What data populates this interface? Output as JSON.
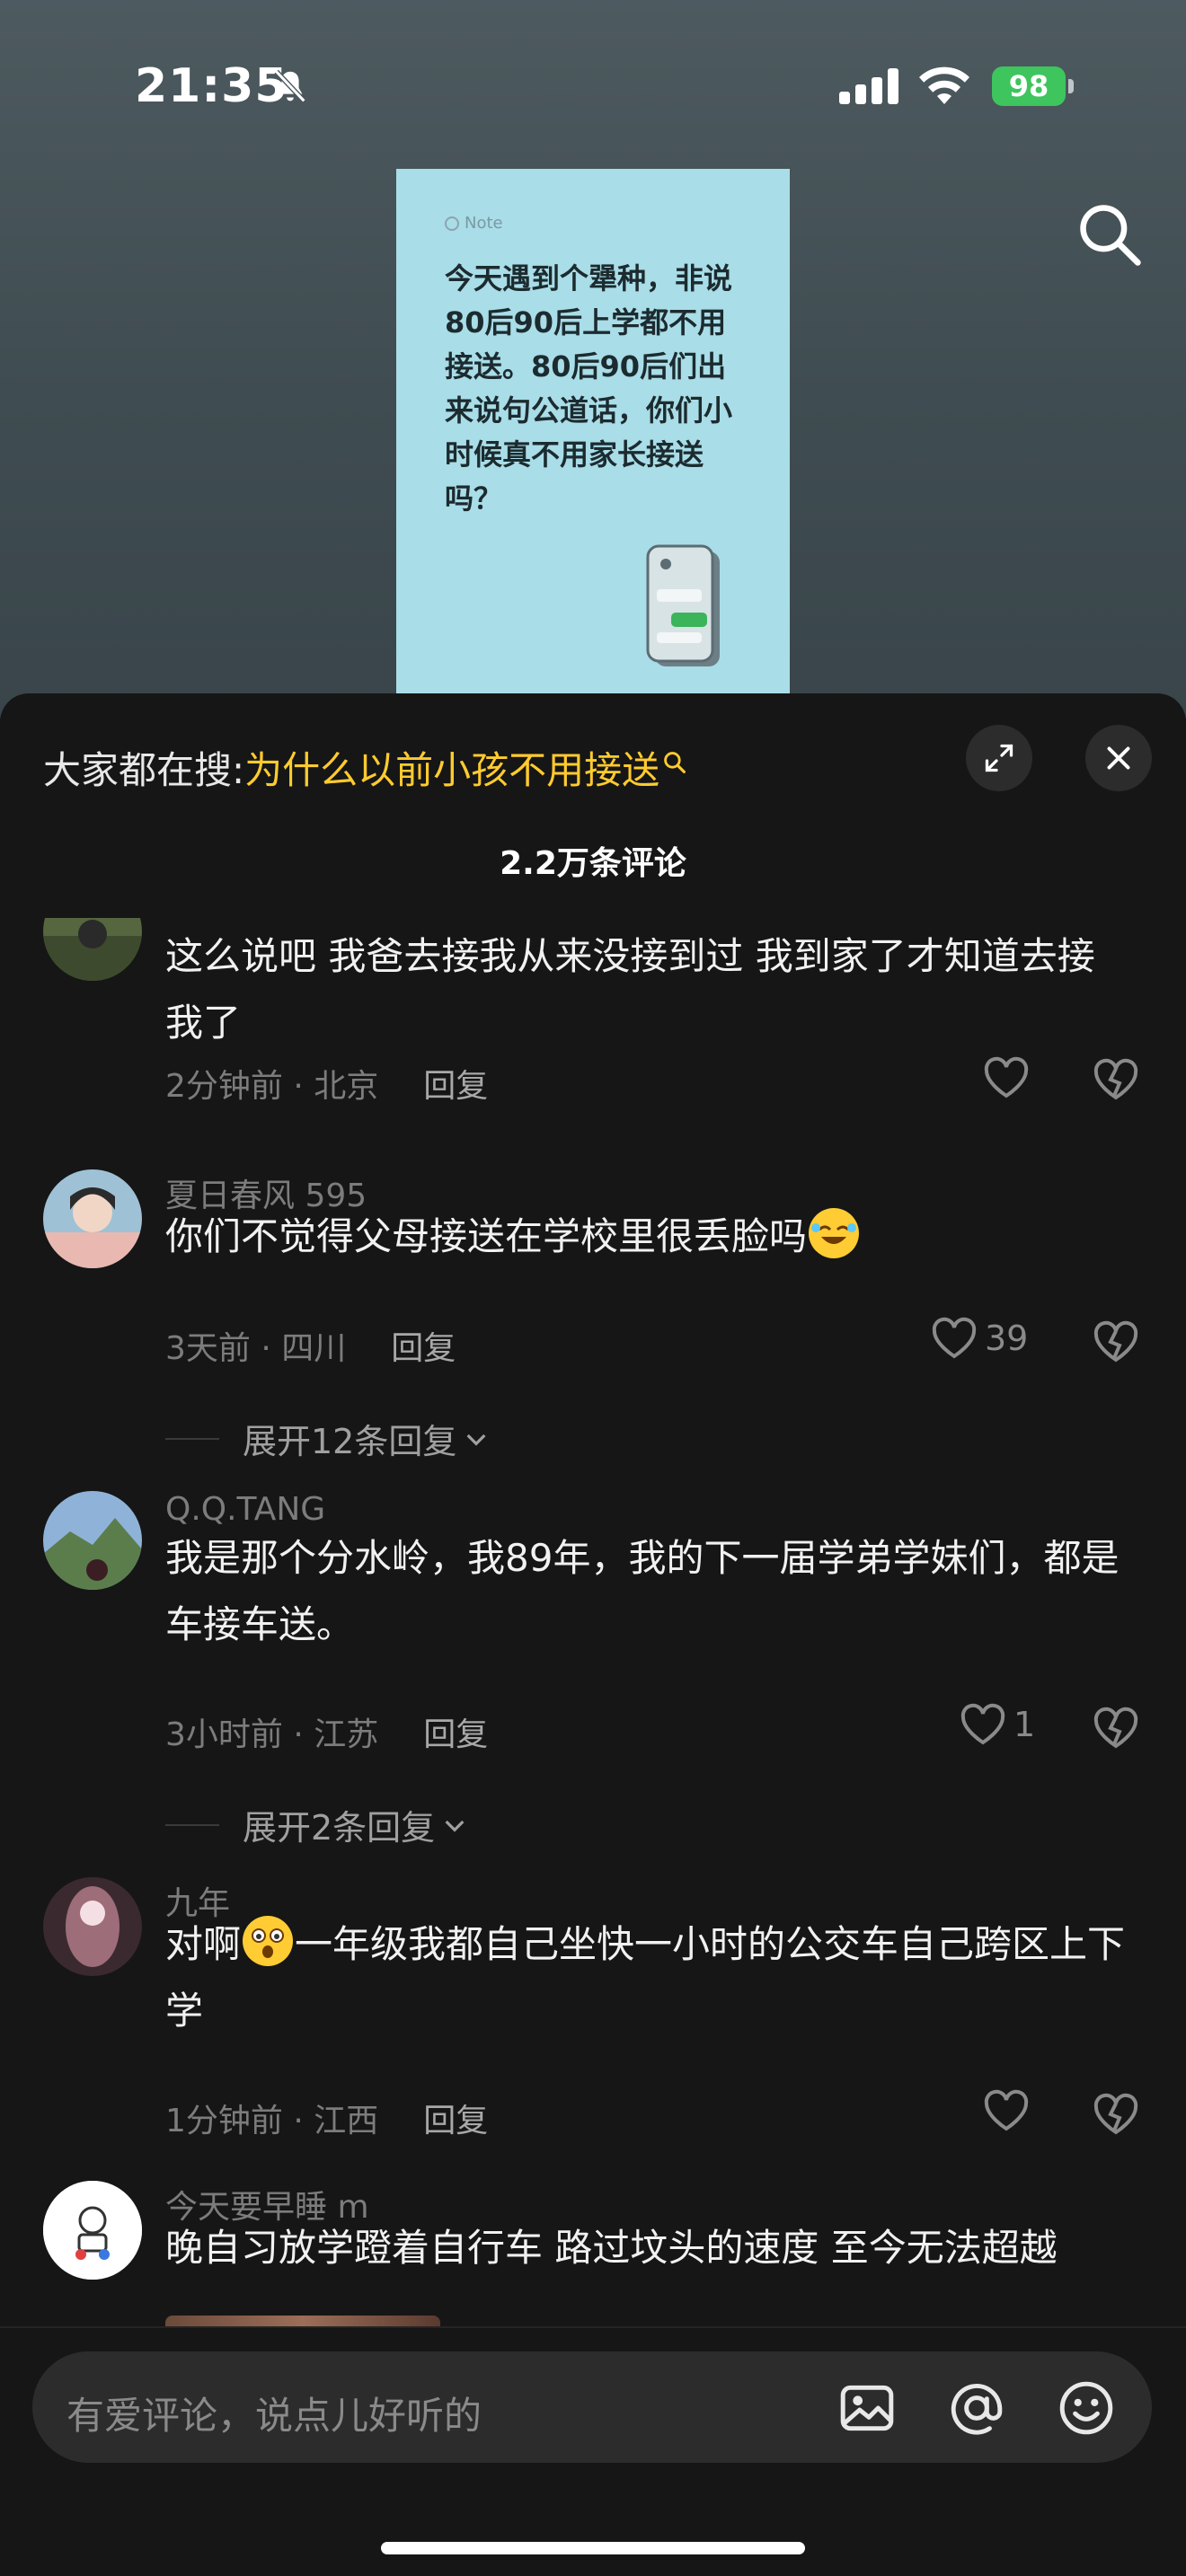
{
  "status_bar": {
    "time": "21:35",
    "battery": "98"
  },
  "video": {
    "note_tag": "Note",
    "note_text": "今天遇到个犟种，非说80后90后上学都不用接送。80后90后们出来说句公道话，你们小时候真不用家长接送吗？"
  },
  "sheet": {
    "hot_search_prefix": "大家都在搜:",
    "hot_search_query": "为什么以前小孩不用接送",
    "comment_count": "2.2万条评论"
  },
  "comments": [
    {
      "author": "",
      "text": "这么说吧 我爸去接我从来没接到过 我到家了才知道去接我了",
      "time_location": "2分钟前 · 北京",
      "reply": "回复",
      "likes": ""
    },
    {
      "author": "夏日春风 595",
      "text": "你们不觉得父母接送在学校里很丢脸吗",
      "time_location": "3天前 · 四川",
      "reply": "回复",
      "likes": "39",
      "expand_replies": "展开12条回复"
    },
    {
      "author": "Q.Q.TANG",
      "text": "我是那个分水岭，我89年，我的下一届学弟学妹们，都是车接车送。",
      "time_location": "3小时前 · 江苏",
      "reply": "回复",
      "likes": "1",
      "expand_replies": "展开2条回复"
    },
    {
      "author": "九年",
      "text_before_emoji": "对啊",
      "text_after_emoji": "一年级我都自己坐快一小时的公交车自己跨区上下学",
      "time_location": "1分钟前 · 江西",
      "reply": "回复",
      "likes": ""
    },
    {
      "author": "今天要早睡 m",
      "text": "晚自习放学蹬着自行车 路过坟头的速度 至今无法超越"
    }
  ],
  "input_bar": {
    "placeholder": "有爱评论，说点儿好听的"
  },
  "colors": {
    "sheet_bg": "#161616",
    "hot_search_accent": "#ffcb2f",
    "input_bg": "#2c2c2c",
    "battery_green": "#3ec55e"
  },
  "icons": [
    "mute-icon",
    "signal-icon",
    "wifi-icon",
    "search-icon",
    "expand-icon",
    "close-icon",
    "heart-icon",
    "dislike-icon",
    "chevron-down-icon",
    "image-icon",
    "at-icon",
    "emoji-icon"
  ]
}
